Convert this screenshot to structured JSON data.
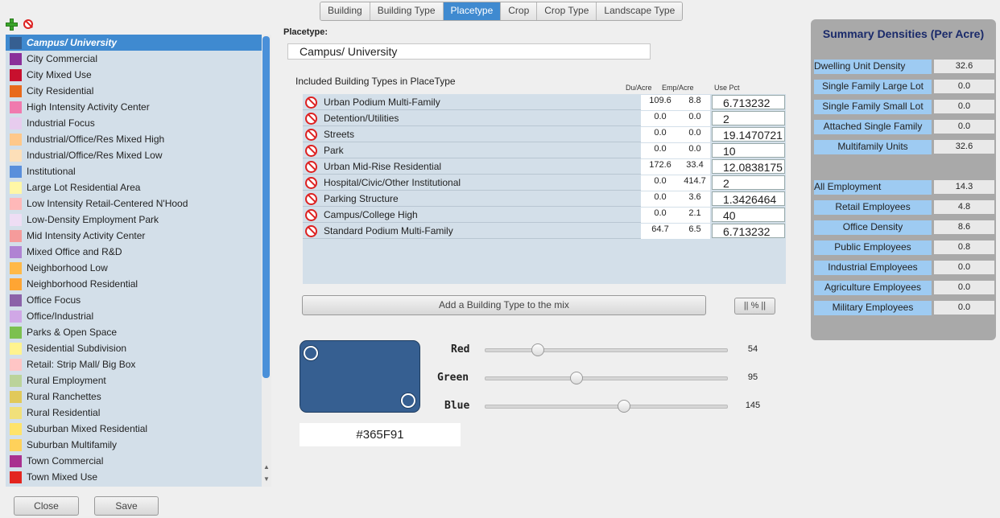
{
  "tabs": [
    {
      "label": "Building"
    },
    {
      "label": "Building Type"
    },
    {
      "label": "Placetype",
      "active": true
    },
    {
      "label": "Crop"
    },
    {
      "label": "Crop Type"
    },
    {
      "label": "Landscape Type"
    }
  ],
  "left_icons": {
    "add": "plus-icon",
    "remove": "no-icon"
  },
  "placetype_list": [
    {
      "label": "Campus/ University",
      "color": "#365F91",
      "selected": true
    },
    {
      "label": "City Commercial",
      "color": "#8B2F9A"
    },
    {
      "label": "City Mixed Use",
      "color": "#C8102E"
    },
    {
      "label": "City Residential",
      "color": "#E86A1C"
    },
    {
      "label": "High Intensity Activity Center",
      "color": "#F07AAE"
    },
    {
      "label": "Industrial Focus",
      "color": "#E7CCEE"
    },
    {
      "label": "Industrial/Office/Res Mixed High",
      "color": "#FFC88A"
    },
    {
      "label": "Industrial/Office/Res Mixed Low",
      "color": "#FDDFB8"
    },
    {
      "label": "Institutional",
      "color": "#5A8FDB"
    },
    {
      "label": "Large Lot Residential Area",
      "color": "#FFF7A6"
    },
    {
      "label": "Low Intensity Retail-Centered N'Hood",
      "color": "#FFB8B8"
    },
    {
      "label": "Low-Density Employment Park",
      "color": "#EEDDF4"
    },
    {
      "label": "Mid Intensity Activity Center",
      "color": "#F59B9B"
    },
    {
      "label": "Mixed Office and R&D",
      "color": "#B083D3"
    },
    {
      "label": "Neighborhood Low",
      "color": "#FFB948"
    },
    {
      "label": "Neighborhood Residential",
      "color": "#FFA533"
    },
    {
      "label": "Office Focus",
      "color": "#8B62A8"
    },
    {
      "label": "Office/Industrial",
      "color": "#D0A7E6"
    },
    {
      "label": "Parks & Open Space",
      "color": "#7CC04F"
    },
    {
      "label": "Residential Subdivision",
      "color": "#FFF38F"
    },
    {
      "label": "Retail: Strip Mall/ Big Box",
      "color": "#FFC5C5"
    },
    {
      "label": "Rural Employment",
      "color": "#BBD39A"
    },
    {
      "label": "Rural Ranchettes",
      "color": "#E1C95A"
    },
    {
      "label": "Rural Residential",
      "color": "#F1E07A"
    },
    {
      "label": "Suburban Mixed Residential",
      "color": "#FFE36A"
    },
    {
      "label": "Suburban Multifamily",
      "color": "#FFD15A"
    },
    {
      "label": "Town Commercial",
      "color": "#A9308F"
    },
    {
      "label": "Town Mixed Use",
      "color": "#E3251F"
    }
  ],
  "placetype_label": "Placetype:",
  "placetype_value": "Campus/ University",
  "included_label": "Included Building Types in PlaceType",
  "col_headers": {
    "du": "Du/Acre",
    "emp": "Emp/Acre",
    "pct": "Use Pct"
  },
  "building_types": [
    {
      "name": "Urban Podium Multi-Family",
      "du": "109.6",
      "emp": "8.8",
      "pct": "6.713232"
    },
    {
      "name": "Detention/Utilities",
      "du": "0.0",
      "emp": "0.0",
      "pct": "2"
    },
    {
      "name": "Streets",
      "du": "0.0",
      "emp": "0.0",
      "pct": "19.1470721"
    },
    {
      "name": "Park",
      "du": "0.0",
      "emp": "0.0",
      "pct": "10"
    },
    {
      "name": "Urban Mid-Rise Residential",
      "du": "172.6",
      "emp": "33.4",
      "pct": "12.0838175"
    },
    {
      "name": "Hospital/Civic/Other Institutional",
      "du": "0.0",
      "emp": "414.7",
      "pct": "2"
    },
    {
      "name": "Parking Structure",
      "du": "0.0",
      "emp": "3.6",
      "pct": "1.3426464"
    },
    {
      "name": "Campus/College High",
      "du": "0.0",
      "emp": "2.1",
      "pct": "40"
    },
    {
      "name": "Standard Podium Multi-Family",
      "du": "64.7",
      "emp": "6.5",
      "pct": "6.713232"
    }
  ],
  "add_button": "Add a Building Type to the mix",
  "pct_button": "|| % ||",
  "color": {
    "hex": "#365F91",
    "swatch": "#365F91",
    "red": {
      "label": "Red",
      "value": "54",
      "fraction": 0.212
    },
    "green": {
      "label": "Green",
      "value": "95",
      "fraction": 0.373
    },
    "blue": {
      "label": "Blue",
      "value": "145",
      "fraction": 0.569
    }
  },
  "summary": {
    "title": "Summary Densities (Per Acre)",
    "rows": [
      {
        "label": "Dwelling Unit Density",
        "value": "32.6",
        "align": "left"
      },
      {
        "label": "Single Family Large Lot",
        "value": "0.0",
        "align": "center"
      },
      {
        "label": "Single Family Small Lot",
        "value": "0.0",
        "align": "center"
      },
      {
        "label": "Attached Single Family",
        "value": "0.0",
        "align": "center"
      },
      {
        "label": "Multifamily Units",
        "value": "32.6",
        "align": "center"
      },
      {
        "label": "All Employment",
        "value": "14.3",
        "align": "left"
      },
      {
        "label": "Retail Employees",
        "value": "4.8",
        "align": "center"
      },
      {
        "label": "Office Density",
        "value": "8.6",
        "align": "center"
      },
      {
        "label": "Public Employees",
        "value": "0.8",
        "align": "center"
      },
      {
        "label": "Industrial Employees",
        "value": "0.0",
        "align": "center"
      },
      {
        "label": "Agriculture Employees",
        "value": "0.0",
        "align": "center"
      },
      {
        "label": "Military Employees",
        "value": "0.0",
        "align": "center"
      }
    ]
  },
  "footer": {
    "close": "Close",
    "save": "Save"
  }
}
